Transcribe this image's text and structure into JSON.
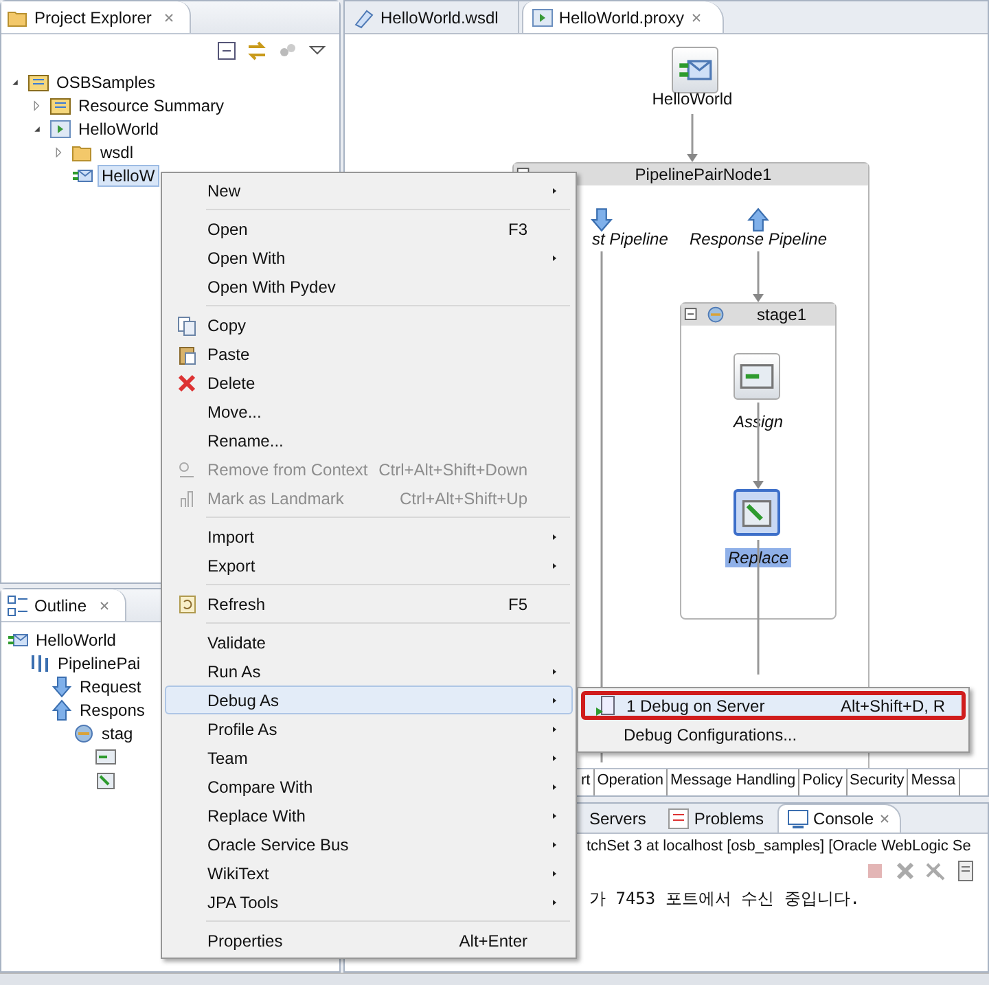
{
  "project_explorer": {
    "title": "Project Explorer",
    "tree": [
      {
        "label": "OSBSamples",
        "expanded": true,
        "selected": false,
        "children": [
          {
            "label": "Resource Summary",
            "expanded": false,
            "selected": false
          },
          {
            "label": "HelloWorld",
            "expanded": true,
            "selected": false,
            "children": [
              {
                "label": "wsdl",
                "expanded": false,
                "selected": false
              },
              {
                "label": "HelloW",
                "selected": true
              }
            ]
          }
        ]
      }
    ]
  },
  "outline": {
    "title": "Outline",
    "tree": [
      {
        "label": "HelloWorld",
        "children": [
          {
            "label": "PipelinePai",
            "children": [
              {
                "label": "Request"
              },
              {
                "label": "Respons",
                "children": [
                  {
                    "label": "stag",
                    "children": [
                      {
                        "kind": "assign"
                      },
                      {
                        "kind": "replace"
                      }
                    ]
                  }
                ]
              }
            ]
          }
        ]
      }
    ]
  },
  "editor_tabs": [
    {
      "label": "HelloWorld.wsdl",
      "selected": false
    },
    {
      "label": "HelloWorld.proxy",
      "selected": true
    }
  ],
  "diagram": {
    "service": "HelloWorld",
    "pipeline_pair": "PipelinePairNode1",
    "request_pipeline": "st Pipeline",
    "response_pipeline": "Response Pipeline",
    "stage": "stage1",
    "actions": [
      {
        "label": "Assign",
        "selected": false
      },
      {
        "label": "Replace",
        "selected": true
      }
    ]
  },
  "property_tabs": [
    "rt",
    "Operation",
    "Message Handling",
    "Policy",
    "Security",
    "Messa"
  ],
  "console": {
    "tabs": [
      {
        "label": "Servers",
        "selected": false
      },
      {
        "label": "Problems",
        "selected": false
      },
      {
        "label": "Console",
        "selected": true
      }
    ],
    "description": "tchSet 3 at localhost [osb_samples] [Oracle WebLogic Se",
    "output": "가 7453 포트에서 수신 중입니다."
  },
  "context_menu": [
    [
      {
        "label": "New",
        "submenu": true,
        "disabled": false,
        "selected": false
      }
    ],
    [
      {
        "label": "Open",
        "shortcut": "F3",
        "submenu": false,
        "disabled": false,
        "selected": false
      },
      {
        "label": "Open With",
        "submenu": true,
        "disabled": false,
        "selected": false
      },
      {
        "label": "Open With Pydev",
        "submenu": false,
        "disabled": false,
        "selected": false
      }
    ],
    [
      {
        "label": "Copy",
        "submenu": false,
        "disabled": false,
        "selected": false
      },
      {
        "label": "Paste",
        "submenu": false,
        "disabled": false,
        "selected": false
      },
      {
        "label": "Delete",
        "submenu": false,
        "disabled": false,
        "selected": false
      },
      {
        "label": "Move...",
        "submenu": false,
        "disabled": false,
        "selected": false
      },
      {
        "label": "Rename...",
        "submenu": false,
        "disabled": false,
        "selected": false
      },
      {
        "label": "Remove from Context",
        "shortcut": "Ctrl+Alt+Shift+Down",
        "submenu": false,
        "disabled": true,
        "selected": false
      },
      {
        "label": "Mark as Landmark",
        "shortcut": "Ctrl+Alt+Shift+Up",
        "submenu": false,
        "disabled": true,
        "selected": false
      }
    ],
    [
      {
        "label": "Import",
        "submenu": true,
        "disabled": false,
        "selected": false
      },
      {
        "label": "Export",
        "submenu": true,
        "disabled": false,
        "selected": false
      }
    ],
    [
      {
        "label": "Refresh",
        "shortcut": "F5",
        "submenu": false,
        "disabled": false,
        "selected": false
      }
    ],
    [
      {
        "label": "Validate",
        "submenu": false,
        "disabled": false,
        "selected": false
      },
      {
        "label": "Run As",
        "submenu": true,
        "disabled": false,
        "selected": false
      },
      {
        "label": "Debug As",
        "submenu": true,
        "disabled": false,
        "selected": true
      },
      {
        "label": "Profile As",
        "submenu": true,
        "disabled": false,
        "selected": false
      },
      {
        "label": "Team",
        "submenu": true,
        "disabled": false,
        "selected": false
      },
      {
        "label": "Compare With",
        "submenu": true,
        "disabled": false,
        "selected": false
      },
      {
        "label": "Replace With",
        "submenu": true,
        "disabled": false,
        "selected": false
      },
      {
        "label": "Oracle Service Bus",
        "submenu": true,
        "disabled": false,
        "selected": false
      },
      {
        "label": "WikiText",
        "submenu": true,
        "disabled": false,
        "selected": false
      },
      {
        "label": "JPA Tools",
        "submenu": true,
        "disabled": false,
        "selected": false
      }
    ],
    [
      {
        "label": "Properties",
        "shortcut": "Alt+Enter",
        "submenu": false,
        "disabled": false,
        "selected": false
      }
    ]
  ],
  "submenu": [
    {
      "label": "1 Debug on Server",
      "shortcut": "Alt+Shift+D, R",
      "selected": true,
      "annotated": true
    },
    {
      "label": "Debug Configurations...",
      "selected": false,
      "annotated": false
    }
  ]
}
